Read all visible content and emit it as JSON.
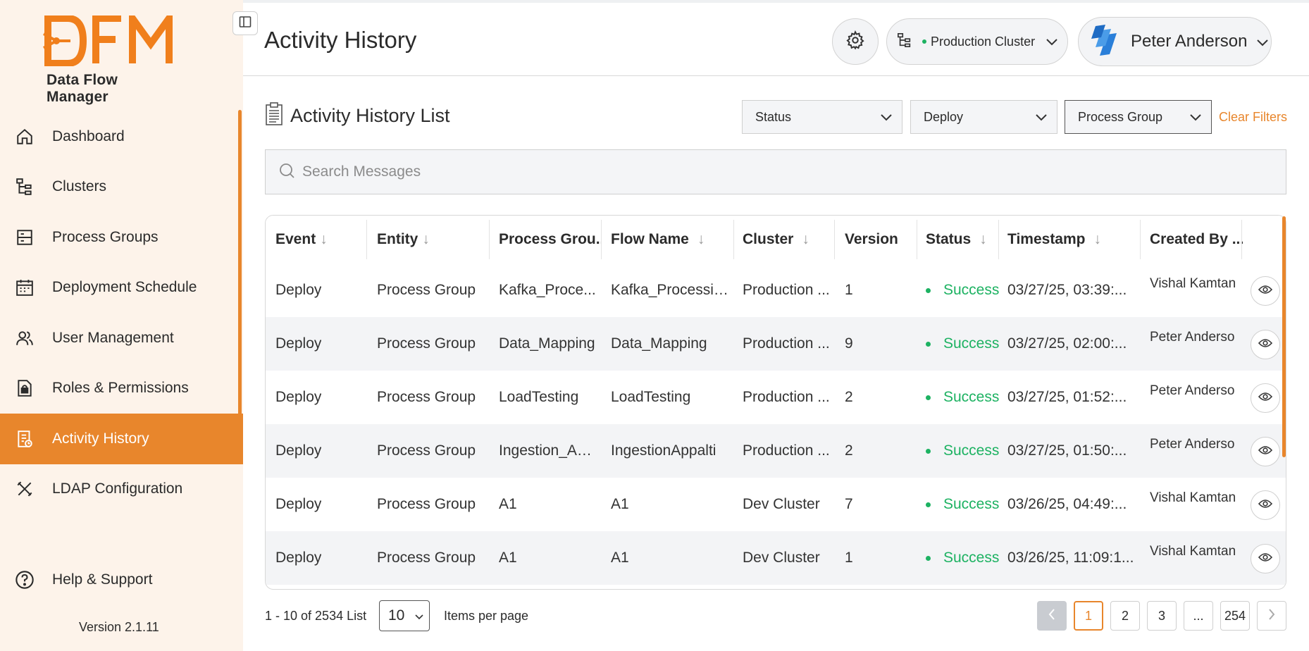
{
  "app": {
    "logo_text": "DFM",
    "logo_subtitle": "Data Flow Manager",
    "version": "Version 2.1.11",
    "accent_color": "#e8862c",
    "success_color": "#1db262"
  },
  "sidebar": {
    "items": [
      {
        "label": "Dashboard",
        "icon": "home-icon"
      },
      {
        "label": "Clusters",
        "icon": "cluster-tree-icon"
      },
      {
        "label": "Process Groups",
        "icon": "process-group-icon"
      },
      {
        "label": "Deployment Schedule",
        "icon": "calendar-icon"
      },
      {
        "label": "User Management",
        "icon": "users-icon"
      },
      {
        "label": "Roles & Permissions",
        "icon": "lock-doc-icon"
      },
      {
        "label": "Activity History",
        "icon": "history-doc-icon",
        "active": true
      },
      {
        "label": "LDAP Configuration",
        "icon": "tools-icon"
      }
    ],
    "help_label": "Help & Support"
  },
  "header": {
    "title": "Activity History",
    "cluster_label": "Production Cluster",
    "user_name": "Peter Anderson"
  },
  "list": {
    "title": "Activity History List",
    "filters": {
      "status": "Status",
      "deploy": "Deploy",
      "process_group": "Process Group",
      "clear": "Clear Filters"
    },
    "search_placeholder": "Search Messages"
  },
  "table": {
    "columns": [
      "Event",
      "Entity",
      "Process Grou...",
      "Flow Name",
      "Cluster",
      "Version",
      "Status",
      "Timestamp",
      "Created By ..."
    ],
    "rows": [
      {
        "event": "Deploy",
        "entity": "Process Group",
        "process_group": "Kafka_Proce...",
        "flow_name": "Kafka_Processing",
        "cluster": "Production ...",
        "version": "1",
        "status": "Success",
        "timestamp": "03/27/25, 03:39:...",
        "created_by": "Vishal Kamtan"
      },
      {
        "event": "Deploy",
        "entity": "Process Group",
        "process_group": "Data_Mapping",
        "flow_name": "Data_Mapping",
        "cluster": "Production ...",
        "version": "9",
        "status": "Success",
        "timestamp": "03/27/25, 02:00:...",
        "created_by": "Peter Anderso"
      },
      {
        "event": "Deploy",
        "entity": "Process Group",
        "process_group": "LoadTesting",
        "flow_name": "LoadTesting",
        "cluster": "Production ...",
        "version": "2",
        "status": "Success",
        "timestamp": "03/27/25, 01:52:...",
        "created_by": "Peter Anderso"
      },
      {
        "event": "Deploy",
        "entity": "Process Group",
        "process_group": "Ingestion_Ap...",
        "flow_name": "IngestionAppalti",
        "cluster": "Production ...",
        "version": "2",
        "status": "Success",
        "timestamp": "03/27/25, 01:50:...",
        "created_by": "Peter Anderso"
      },
      {
        "event": "Deploy",
        "entity": "Process Group",
        "process_group": "A1",
        "flow_name": "A1",
        "cluster": "Dev Cluster",
        "version": "7",
        "status": "Success",
        "timestamp": "03/26/25, 04:49:...",
        "created_by": "Vishal Kamtan"
      },
      {
        "event": "Deploy",
        "entity": "Process Group",
        "process_group": "A1",
        "flow_name": "A1",
        "cluster": "Dev Cluster",
        "version": "1",
        "status": "Success",
        "timestamp": "03/26/25, 11:09:1...",
        "created_by": "Vishal Kamtan"
      }
    ]
  },
  "pagination": {
    "range_text": "1 - 10 of 2534 List",
    "per_page": "10",
    "per_page_label": "Items per page",
    "pages": [
      "1",
      "2",
      "3",
      "...",
      "254"
    ],
    "current_page": "1"
  }
}
